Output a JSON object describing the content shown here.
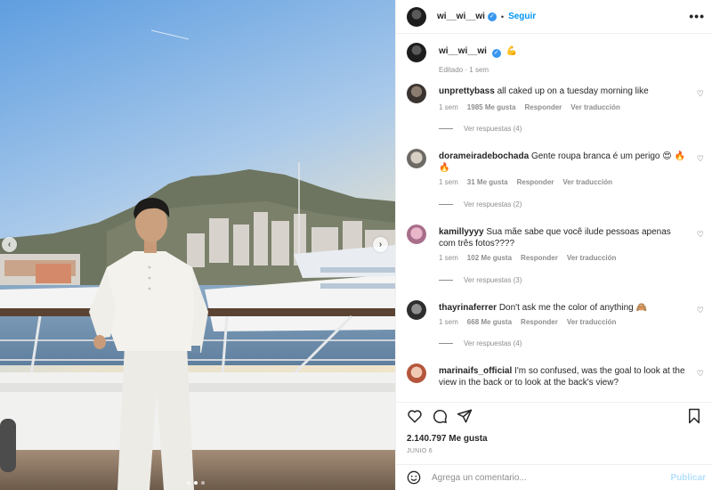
{
  "header": {
    "username": "wi__wi__wi",
    "separator": "•",
    "follow_label": "Seguir",
    "more_label": "•••"
  },
  "caption": {
    "username": "wi__wi__wi",
    "emoji": "💪",
    "edited": "Editado",
    "time": "1 sem"
  },
  "comments": [
    {
      "username": "unprettybass",
      "text": "all caked up on a tuesday morning like",
      "time": "1 sem",
      "likes": "1985 Me gusta",
      "reply": "Responder",
      "translate": "Ver traducción",
      "replies": "Ver respuestas (4)"
    },
    {
      "username": "dorameiradebochada",
      "text": "Gente roupa branca é um perigo 😍 🔥",
      "text2": "🔥",
      "time": "1 sem",
      "likes": "31 Me gusta",
      "reply": "Responder",
      "translate": "Ver traducción",
      "replies": "Ver respuestas (2)"
    },
    {
      "username": "kamillyyyy",
      "text": "Sua mãe sabe que você ilude pessoas apenas com três fotos????",
      "time": "1 sem",
      "likes": "102 Me gusta",
      "reply": "Responder",
      "translate": "Ver traducción",
      "replies": "Ver respuestas (3)"
    },
    {
      "username": "thayrinaferrer",
      "text": "Don't ask me the color of anything 🙈",
      "time": "1 sem",
      "likes": "668 Me gusta",
      "reply": "Responder",
      "translate": "Ver traducción",
      "replies": "Ver respuestas (4)"
    },
    {
      "username": "marinaifs_official",
      "text": "I'm so confused, was the goal to look at the view in the back or to look at the back's view?"
    }
  ],
  "post": {
    "likes": "2.140.797 Me gusta",
    "date": "JUNIO 6"
  },
  "add_comment": {
    "placeholder": "Agrega un comentario...",
    "publish_label": "Publicar"
  },
  "carousel": {
    "current": 2,
    "total": 3
  },
  "colors": {
    "accent": "#0095f6",
    "publish_disabled": "#b2dffc",
    "muted": "#8e8e8e"
  },
  "icons": [
    "heart-icon",
    "comment-icon",
    "share-icon",
    "bookmark-icon",
    "emoji-icon",
    "verified-icon",
    "chevron-left-icon",
    "chevron-right-icon"
  ]
}
